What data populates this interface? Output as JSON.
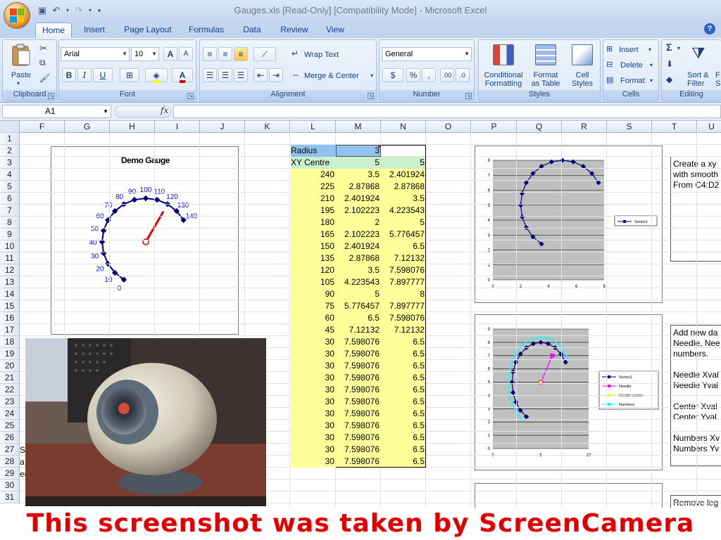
{
  "window": {
    "title": "Gauges.xls  [Read-Only]  [Compatibility Mode] - Microsoft Excel"
  },
  "tabs": [
    "Home",
    "Insert",
    "Page Layout",
    "Formulas",
    "Data",
    "Review",
    "View"
  ],
  "ribbon": {
    "clipboard": {
      "label": "Clipboard",
      "paste": "Paste"
    },
    "font": {
      "label": "Font",
      "name": "Arial",
      "size": "10",
      "bold": "B",
      "italic": "I",
      "underline": "U",
      "grow": "A",
      "shrink": "A",
      "fill_letter": "",
      "font_color_letter": "A"
    },
    "alignment": {
      "label": "Alignment",
      "wrap": "Wrap Text",
      "merge": "Merge & Center"
    },
    "number": {
      "label": "Number",
      "format": "General",
      "currency": "$",
      "percent": "%",
      "comma": ",",
      "inc": ".00",
      "dec": ".0"
    },
    "styles": {
      "label": "Styles",
      "conditional": "Conditional\nFormatting",
      "format_table": "Format\nas Table",
      "cell_styles": "Cell\nStyles"
    },
    "cells": {
      "label": "Cells",
      "insert": "Insert",
      "delete": "Delete",
      "format": "Format"
    },
    "editing": {
      "label": "Editing",
      "sum": "Σ",
      "sort": "Sort &\nFilter",
      "find": "F\nS"
    }
  },
  "formula_bar": {
    "name_box": "A1",
    "fx": "fx",
    "content": ""
  },
  "columns": [
    "F",
    "G",
    "H",
    "I",
    "J",
    "K",
    "L",
    "M",
    "N",
    "O",
    "P",
    "Q",
    "R",
    "S",
    "T",
    "U"
  ],
  "rows": [
    "1",
    "2",
    "3",
    "4",
    "5",
    "6",
    "7",
    "8",
    "9",
    "10",
    "11",
    "12",
    "13",
    "14",
    "15",
    "16",
    "17",
    "18",
    "19",
    "20",
    "21",
    "22",
    "23",
    "24",
    "25",
    "26",
    "27",
    "28",
    "29",
    "30",
    "31"
  ],
  "table": {
    "radius_label": "Radius",
    "radius_value": "3",
    "centre_label": "XY Centre",
    "centre_x": "5",
    "centre_y": "5",
    "rows": [
      [
        "240",
        "3.5",
        "2.401924"
      ],
      [
        "225",
        "2.87868",
        "2.87868"
      ],
      [
        "210",
        "2.401924",
        "3.5"
      ],
      [
        "195",
        "2.102223",
        "4.223543"
      ],
      [
        "180",
        "2",
        "5"
      ],
      [
        "165",
        "2.102223",
        "5.776457"
      ],
      [
        "150",
        "2.401924",
        "6.5"
      ],
      [
        "135",
        "2.87868",
        "7.12132"
      ],
      [
        "120",
        "3.5",
        "7.598076"
      ],
      [
        "105",
        "4.223543",
        "7.897777"
      ],
      [
        "90",
        "5",
        "8"
      ],
      [
        "75",
        "5.776457",
        "7.897777"
      ],
      [
        "60",
        "6.5",
        "7.598076"
      ],
      [
        "45",
        "7.12132",
        "7.12132"
      ],
      [
        "30",
        "7.598076",
        "6.5"
      ],
      [
        "30",
        "7.598076",
        "6.5"
      ],
      [
        "30",
        "7.598076",
        "6.5"
      ],
      [
        "30",
        "7.598076",
        "6.5"
      ],
      [
        "30",
        "7.598076",
        "6.5"
      ],
      [
        "30",
        "7.598076",
        "6.5"
      ],
      [
        "30",
        "7.598076",
        "6.5"
      ],
      [
        "30",
        "7.598076",
        "6.5"
      ],
      [
        "30",
        "7.598076",
        "6.5"
      ],
      [
        "30",
        "7.598076",
        "6.5"
      ],
      [
        "30",
        "7.598076",
        "6.5"
      ]
    ]
  },
  "gauge": {
    "title": "Demo Gauge",
    "labels": [
      "0",
      "10",
      "20",
      "30",
      "40",
      "50",
      "60",
      "70",
      "80",
      "90",
      "100",
      "110",
      "120",
      "130",
      "140"
    ],
    "needle_value": 120
  },
  "charts": {
    "chart1": {
      "yticks": [
        "8",
        "7",
        "6",
        "5",
        "4",
        "3",
        "2",
        "1",
        "0"
      ],
      "xticks": [
        "0",
        "2",
        "4",
        "6",
        "8"
      ],
      "legend": [
        "Series1"
      ]
    },
    "chart2": {
      "yticks": [
        "9",
        "8",
        "7",
        "6",
        "5",
        "4",
        "3",
        "2",
        "1",
        "0"
      ],
      "xticks": [
        "0",
        "5",
        "10"
      ],
      "legend": [
        "Series1",
        "Needle",
        "Needle center",
        "Numbers"
      ]
    }
  },
  "notes": {
    "note1": "Create a xy\nwith smooth\nFrom C4:D2",
    "note2": "Add new da\nNeedle, Nee\nnumbers.\n\nNeedle Xval\nNeedle Yval\n\nCenter Xval\nCenter Yval\n\nNumbers Xv\nNumbers Yv",
    "note3": "Remove leg"
  },
  "left_fragments": {
    "r27": "S",
    "r28": "a",
    "r29": "e("
  },
  "banner": "This screenshot was taken by ScreenCamera",
  "colors": {
    "accent": "#15428b",
    "radius_fill": "#8fc3ef",
    "centre_fill": "#ccf0cc",
    "data_fill": "#ffff99",
    "needle": "#e00000",
    "gauge_series": "#00007a"
  }
}
